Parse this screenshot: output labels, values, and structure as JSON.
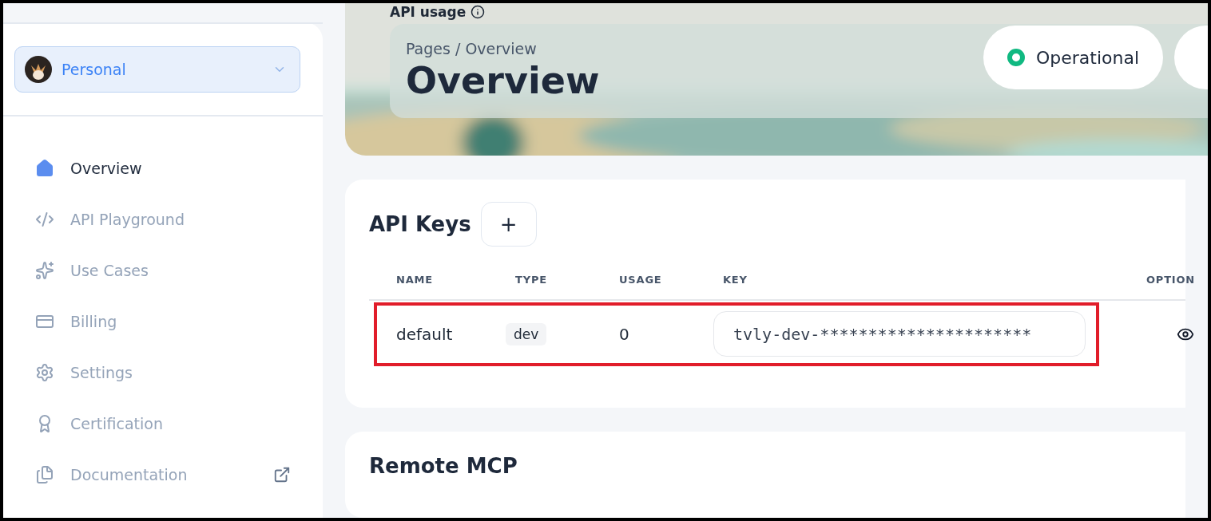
{
  "sidebar": {
    "account": {
      "name": "Personal"
    },
    "items": [
      {
        "label": "Overview",
        "selected": true,
        "external": false
      },
      {
        "label": "API Playground",
        "selected": false,
        "external": false
      },
      {
        "label": "Use Cases",
        "selected": false,
        "external": false
      },
      {
        "label": "Billing",
        "selected": false,
        "external": false
      },
      {
        "label": "Settings",
        "selected": false,
        "external": false
      },
      {
        "label": "Certification",
        "selected": false,
        "external": false
      },
      {
        "label": "Documentation",
        "selected": false,
        "external": true
      }
    ]
  },
  "hero": {
    "kind": "picture",
    "usage_title": "API usage",
    "breadcrumb": "Pages / Overview",
    "title": "Overview",
    "status": {
      "label": "Operational",
      "color": "#10b981"
    }
  },
  "api_keys": {
    "title": "API Keys",
    "add_button": "+",
    "columns": [
      "NAME",
      "TYPE",
      "USAGE",
      "KEY",
      "OPTION"
    ],
    "rows": [
      {
        "name": "default",
        "type": "dev",
        "usage": "0",
        "key": "tvly-dev-**********************",
        "highlighted": true
      }
    ]
  },
  "remote_mcp": {
    "title": "Remote MCP"
  }
}
